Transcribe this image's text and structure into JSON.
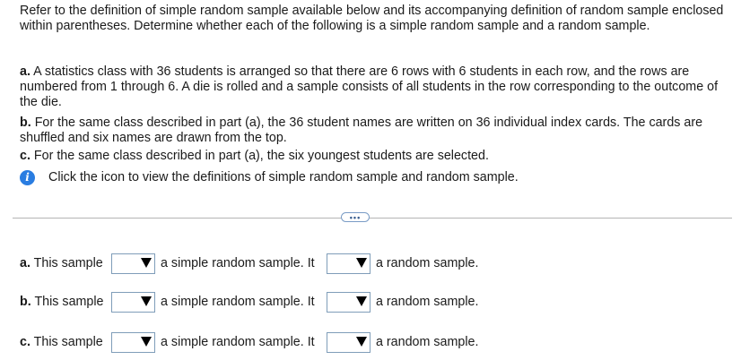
{
  "question": {
    "intro": "Refer to the definition of simple random sample available below and its accompanying definition of random sample enclosed within parentheses. Determine whether each of the following is a simple random sample and a random sample.",
    "parts": {
      "a": {
        "label": "a.",
        "text": "A statistics class with 36 students is arranged so that there are 6 rows with 6 students in each row, and the rows are numbered from 1 through 6. A die is rolled and a sample consists of all students in the row corresponding to the outcome of the die."
      },
      "b": {
        "label": "b.",
        "text": "For the same class described in part (a), the 36 student names are written on 36 individual index cards. The cards are shuffled and six names are drawn from the top."
      },
      "c": {
        "label": "c.",
        "text": "For the same class described in part (a), the six youngest students are selected."
      }
    },
    "info_text": "Click the icon to view the definitions of simple random sample and random sample.",
    "info_icon": "info-icon"
  },
  "divider": {
    "expand_label": "•••"
  },
  "answers": {
    "rows": [
      {
        "prefix_bold": "a.",
        "prefix": "This sample",
        "mid": "a simple random sample. It",
        "end": "a random sample.",
        "select1_value": "",
        "select2_value": ""
      },
      {
        "prefix_bold": "b.",
        "prefix": "This sample",
        "mid": "a simple random sample. It",
        "end": "a random sample.",
        "select1_value": "",
        "select2_value": ""
      },
      {
        "prefix_bold": "c.",
        "prefix": "This sample",
        "mid": "a simple random sample. It",
        "end": "a random sample.",
        "select1_value": "",
        "select2_value": ""
      }
    ]
  },
  "colors": {
    "info_icon": "#2a7de1",
    "dropdown_border": "#7f9db9",
    "divider": "#b5b5b5"
  }
}
